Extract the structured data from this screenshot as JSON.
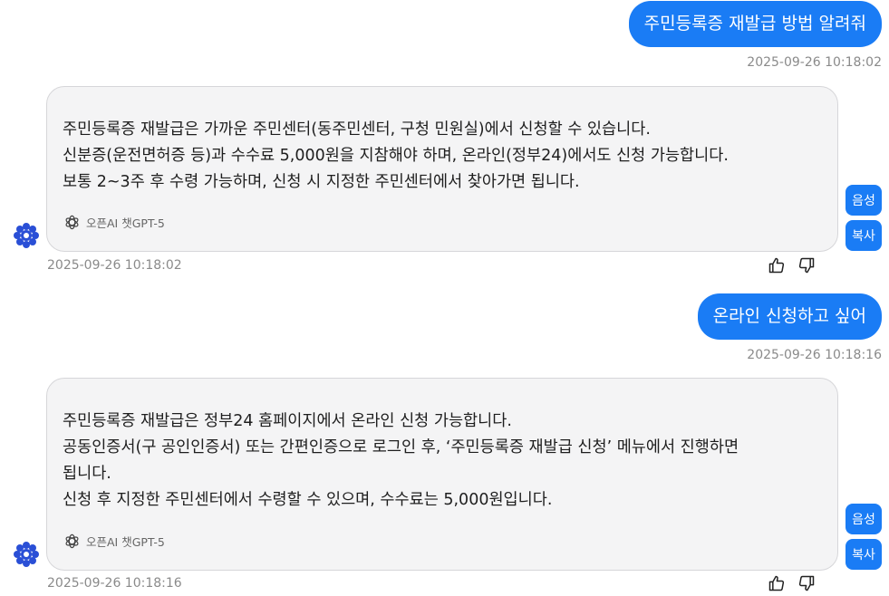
{
  "messages": [
    {
      "role": "user",
      "text": "주민등록증 재발급 방법 알려줘",
      "timestamp": "2025-09-26 10:18:02"
    },
    {
      "role": "assistant",
      "lines": [
        "주민등록증 재발급은 가까운 주민센터(동주민센터, 구청 민원실)에서 신청할 수 있습니다.",
        "신분증(운전면허증 등)과 수수료 5,000원을 지참해야 하며, 온라인(정부24)에서도 신청 가능합니다.",
        "보통 2~3주 후 수령 가능하며, 신청 시 지정한 주민센터에서 찾아가면 됩니다."
      ],
      "source": "오픈AI 챗GPT-5",
      "timestamp": "2025-09-26 10:18:02"
    },
    {
      "role": "user",
      "text": "온라인 신청하고 싶어",
      "timestamp": "2025-09-26 10:18:16"
    },
    {
      "role": "assistant",
      "lines": [
        "주민등록증 재발급은 정부24 홈페이지에서 온라인 신청 가능합니다.",
        "공동인증서(구 공인인증서) 또는 간편인증으로 로그인 후, ‘주민등록증 재발급 신청’ 메뉴에서 진행하면",
        "됩니다.",
        "신청 후 지정한 주민센터에서 수령할 수 있으며, 수수료는 5,000원입니다."
      ],
      "source": "오픈AI 챗GPT-5",
      "timestamp": "2025-09-26 10:18:16"
    }
  ],
  "actions": {
    "voice_label": "음성",
    "copy_label": "복사"
  },
  "icons": {
    "like": "thumbs-up-icon",
    "dislike": "thumbs-down-icon",
    "avatar": "flower-icon",
    "source": "openai-logo-icon"
  },
  "colors": {
    "accent": "#1a7cf5",
    "bot_bg": "#f4f4f5",
    "avatar": "#2a4fd6"
  }
}
